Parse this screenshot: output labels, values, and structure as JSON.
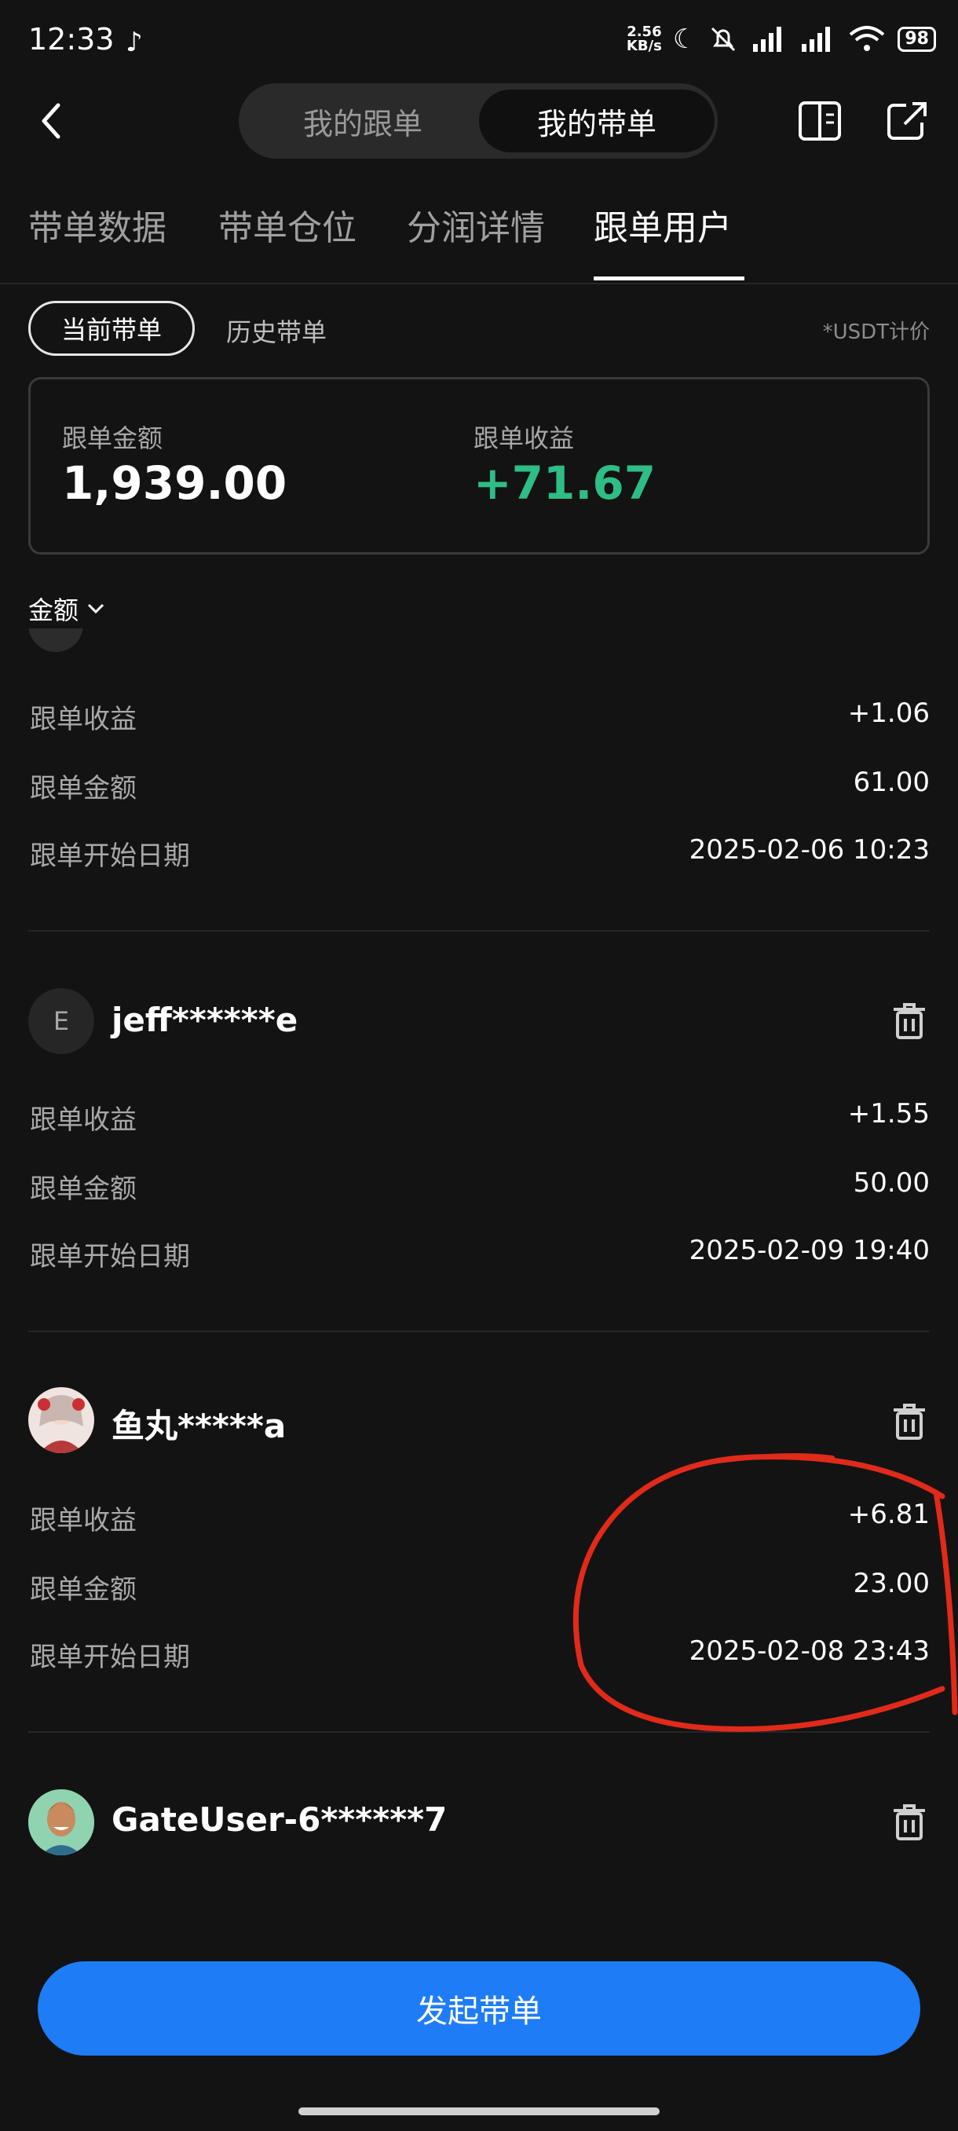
{
  "status_bar": {
    "time": "12:33",
    "net_speed_value": "2.56",
    "net_speed_unit": "KB/s",
    "battery": "98"
  },
  "header": {
    "segments": [
      "我的跟单",
      "我的带单"
    ],
    "active_segment": 1
  },
  "tabs": [
    "带单数据",
    "带单仓位",
    "分润详情",
    "跟单用户"
  ],
  "active_tab": 3,
  "filters": {
    "current": "当前带单",
    "history": "历史带单",
    "currency_note": "*USDT计价"
  },
  "summary": {
    "amount_label": "跟单金额",
    "amount_value": "1,939.00",
    "profit_label": "跟单收益",
    "profit_value": "+71.67"
  },
  "sort": {
    "label": "金额"
  },
  "row_labels": {
    "profit": "跟单收益",
    "amount": "跟单金额",
    "start_date": "跟单开始日期"
  },
  "followers": [
    {
      "name": "",
      "profit": "+1.06",
      "amount": "61.00",
      "start_date": "2025-02-06 10:23"
    },
    {
      "name": "jeff******e",
      "avatar_letter": "E",
      "profit": "+1.55",
      "amount": "50.00",
      "start_date": "2025-02-09 19:40"
    },
    {
      "name": "鱼丸*****a",
      "profit": "+6.81",
      "amount": "23.00",
      "start_date": "2025-02-08 23:43"
    },
    {
      "name": "GateUser-6******7"
    }
  ],
  "cta": {
    "label": "发起带单"
  },
  "colors": {
    "background": "#131313",
    "profit_green": "#2ebd85",
    "primary_blue": "#1f7cf7",
    "annotation_red": "#e02a1a"
  }
}
